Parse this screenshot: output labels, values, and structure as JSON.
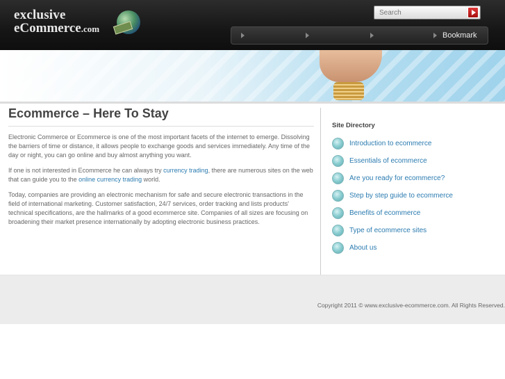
{
  "header": {
    "logo_line1": "exclusive",
    "logo_line2": "eCommerce",
    "logo_suffix": ".com",
    "search_placeholder": "Search",
    "nav_items": [
      "",
      "",
      "",
      "Bookmark"
    ]
  },
  "content": {
    "title": "Ecommerce – Here To Stay",
    "p1": "Electronic Commerce or Ecommerce is one of the most important facets of the internet to emerge. Dissolving the barriers of time or distance, it allows people to exchange goods and services immediately. Any time of the day or night, you can go online and buy almost anything you want.",
    "p2_before": "If one is not interested in Ecommerce he can always try ",
    "p2_link1": "currency trading",
    "p2_mid": ", there are numerous sites on the web that can guide you to the ",
    "p2_link2": "online currency trading",
    "p2_after": " world.",
    "p3": "Today, companies are providing an electronic mechanism for safe and secure electronic transactions in the field of international marketing. Customer satisfaction, 24/7 services, order tracking and lists products' technical specifications, are the hallmarks of a good ecommerce site. Companies of all sizes are focusing on broadening their market presence internationally by adopting electronic business practices."
  },
  "sidebar": {
    "title": "Site Directory",
    "items": [
      "Introduction to ecommerce",
      "Essentials of ecommerce",
      "Are you ready for ecommerce?",
      "Step by step guide to ecommerce",
      "Benefits of ecommerce",
      "Type of ecommerce sites",
      "About us"
    ]
  },
  "footer": {
    "copyright": "Copyright 2011 © www.exclusive-ecommerce.com. All Rights Reserved."
  }
}
